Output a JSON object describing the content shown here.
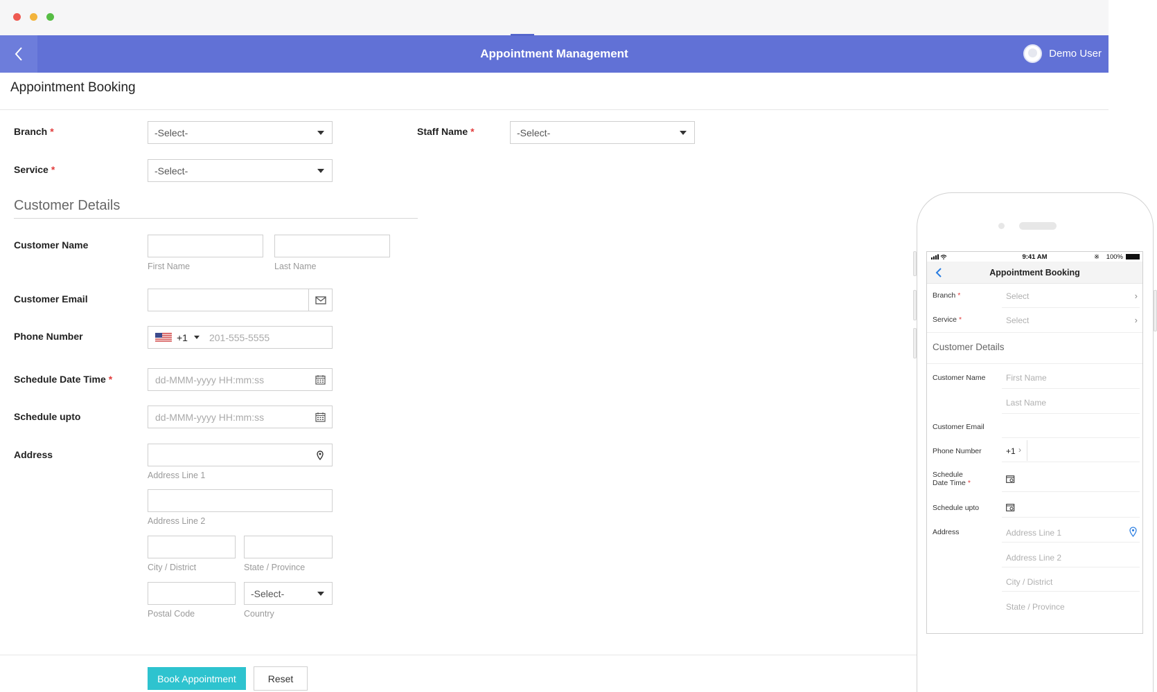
{
  "app": {
    "title": "Appointment Management",
    "user_name": "Demo User",
    "page_title": "Appointment Booking",
    "accent_color": "#6171d6",
    "primary_button_color": "#2ec3cf"
  },
  "form": {
    "branch": {
      "label": "Branch",
      "value": "-Select-"
    },
    "staff": {
      "label": "Staff Name",
      "value": "-Select-"
    },
    "service": {
      "label": "Service",
      "value": "-Select-"
    },
    "customer_section": "Customer Details",
    "customer_name": {
      "label": "Customer Name",
      "first_hint": "First Name",
      "last_hint": "Last Name"
    },
    "customer_email": {
      "label": "Customer Email"
    },
    "phone": {
      "label": "Phone Number",
      "code": "+1",
      "placeholder": "201-555-5555"
    },
    "schedule_date": {
      "label": "Schedule Date Time",
      "placeholder": "dd-MMM-yyyy HH:mm:ss"
    },
    "schedule_upto": {
      "label": "Schedule upto",
      "placeholder": "dd-MMM-yyyy HH:mm:ss"
    },
    "address": {
      "label": "Address",
      "line1": "Address Line 1",
      "line2": "Address Line 2",
      "city": "City / District",
      "state": "State / Province",
      "postal": "Postal Code",
      "country_label": "Country",
      "country_value": "-Select-"
    },
    "required_mark": "*"
  },
  "actions": {
    "book": "Book Appointment",
    "reset": "Reset"
  },
  "mobile": {
    "time": "9:41 AM",
    "battery": "100%",
    "title": "Appointment Booking",
    "branch": "Branch",
    "service": "Service",
    "select": "Select",
    "customer_section": "Customer Details",
    "customer_name": "Customer Name",
    "first_name": "First Name",
    "last_name": "Last Name",
    "customer_email": "Customer Email",
    "phone_number": "Phone Number",
    "phone_code": "+1",
    "schedule_date_1": "Schedule",
    "schedule_date_2": "Date Time",
    "schedule_upto": "Schedule upto",
    "address": "Address",
    "address_line1": "Address Line 1",
    "address_line2": "Address Line 2",
    "city": "City / District",
    "state": "State / Province"
  }
}
